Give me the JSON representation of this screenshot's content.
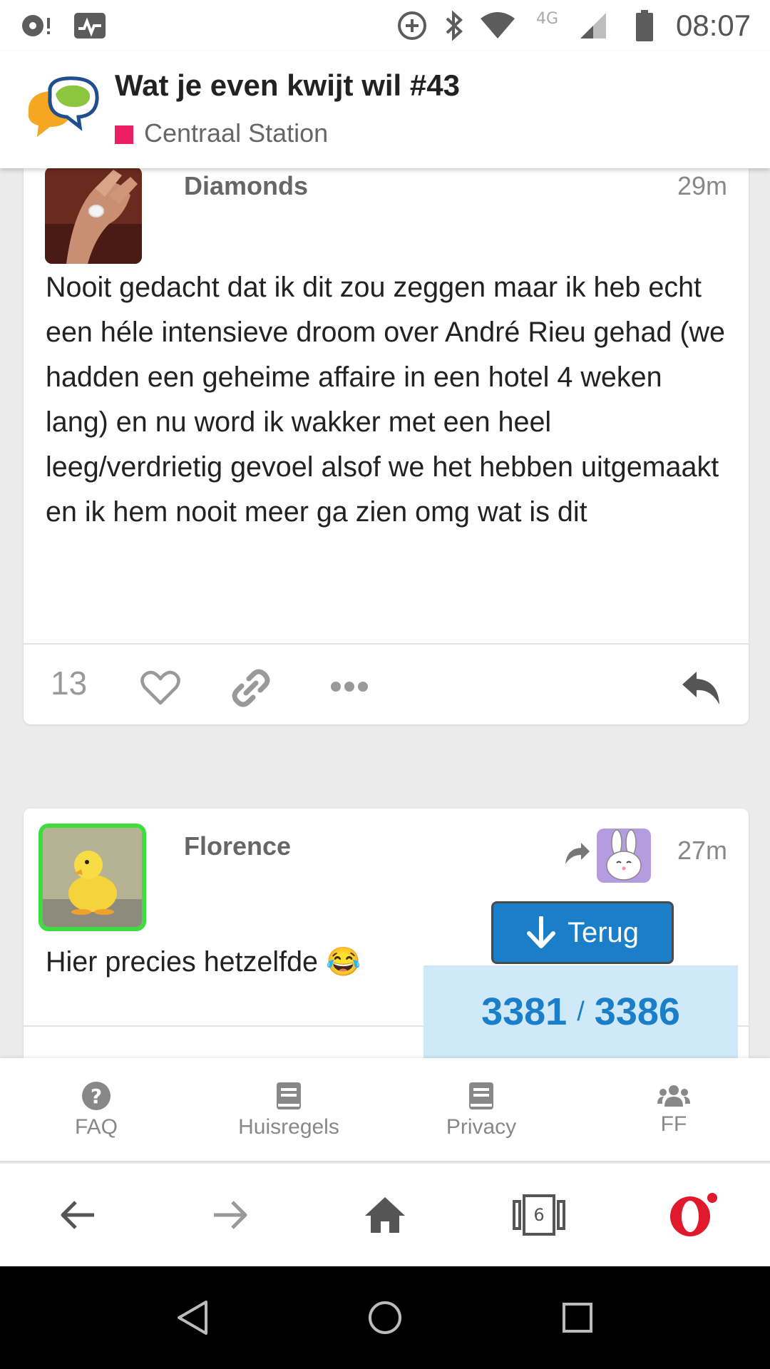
{
  "status_bar": {
    "time": "08:07",
    "network": "4G",
    "icons": [
      "sync-icon",
      "notification-icon",
      "data-saver-icon",
      "bluetooth-icon",
      "wifi-icon",
      "signal-icon",
      "battery-icon"
    ]
  },
  "topic": {
    "title": "Wat je even kwijt wil #43",
    "category": "Centraal Station",
    "category_color": "#e91e63"
  },
  "posts": [
    {
      "username": "Diamonds",
      "time": "29m",
      "body": "Nooit gedacht dat ik dit zou zeggen maar ik heb echt een héle intensieve droom over André Rieu gehad (we hadden een geheime affaire in een hotel 4 weken lang) en nu word ik wakker met een heel leeg/verdrietig gevoel alsof we het hebben uitgemaakt en ik hem nooit meer ga zien omg wat is dit",
      "likes": "13"
    },
    {
      "username": "Florence",
      "time": "27m",
      "body": "Hier precies hetzelfde 😂"
    }
  ],
  "timeline": {
    "back_label": "Terug",
    "current": "3381",
    "total": "3386",
    "separator": "/"
  },
  "footer_nav": [
    {
      "label": "FAQ",
      "icon": "question-icon"
    },
    {
      "label": "Huisregels",
      "icon": "book-icon"
    },
    {
      "label": "Privacy",
      "icon": "book-icon"
    },
    {
      "label": "FF",
      "icon": "users-icon"
    }
  ],
  "browser": {
    "tab_count": "6"
  },
  "colors": {
    "accent": "#1b7ec9",
    "timeline_bg": "#cfe9f9",
    "online_border": "#3fdc3f"
  }
}
